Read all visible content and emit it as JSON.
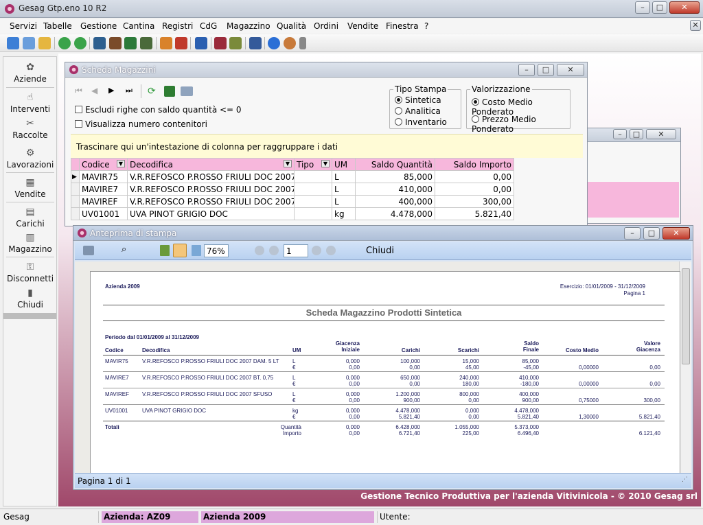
{
  "app": {
    "title": "Gesag Gtp.eno 10 R2",
    "footer": "Gestione Tecnico Produttiva per l'azienda Vitivinicola - © 2010 Gesag srl"
  },
  "menu": [
    "Servizi",
    "Tabelle",
    "Gestione",
    "Cantina",
    "Registri",
    "CdG",
    "Magazzino",
    "Qualità",
    "Ordini",
    "Vendite",
    "Finestra",
    "?"
  ],
  "toolbar_icons": [
    "home-icon",
    "window-icon",
    "folder-icon",
    "green-arrow-icon",
    "green-arrow-icon",
    "chart-icon",
    "book-icon",
    "book-icon",
    "export-icon",
    "report-icon",
    "report-icon",
    "grid-icon",
    "wine-icon",
    "truck-icon",
    "calendar-icon",
    "info-icon",
    "user-icon",
    "overflow-icon"
  ],
  "sidebar": [
    {
      "label": "Aziende",
      "icon": "flower-icon"
    },
    {
      "label": "Interventi",
      "icon": "hand-icon"
    },
    {
      "label": "Raccolte",
      "icon": "shears-icon"
    },
    {
      "label": "Lavorazioni",
      "icon": "machine-icon"
    },
    {
      "label": "Vendite",
      "icon": "register-icon"
    },
    {
      "label": "Carichi",
      "icon": "truck-icon"
    },
    {
      "label": "Magazzino",
      "icon": "warehouse-icon"
    },
    {
      "label": "Disconnetti",
      "icon": "key-icon"
    },
    {
      "label": "Chiudi",
      "icon": "door-icon"
    }
  ],
  "scheda": {
    "title": "Scheda Magazzini",
    "opt_escludi": "Escludi righe con saldo quantità <= 0",
    "opt_contenitori": "Visualizza numero contenitori",
    "tipo_stampa": {
      "label": "Tipo Stampa",
      "options": [
        "Sintetica",
        "Analitica",
        "Inventario"
      ],
      "selected": "Sintetica"
    },
    "valorizzazione": {
      "label": "Valorizzazione",
      "options": [
        "Costo Medio Ponderato",
        "Prezzo Medio Ponderato"
      ],
      "selected": "Costo Medio Ponderato"
    },
    "group_hint": "Trascinare qui un'intestazione di colonna per raggruppare i dati",
    "columns": [
      "Codice",
      "Decodifica",
      "Tipo",
      "UM",
      "Saldo Quantità",
      "Saldo Importo"
    ],
    "rows": [
      [
        "MAVIR75",
        "V.R.REFOSCO P.ROSSO FRIULI DOC 2007 DAM.",
        "",
        "L",
        "85,000",
        "0,00"
      ],
      [
        "MAVIRE7",
        "V.R.REFOSCO P.ROSSO FRIULI DOC 2007 BT. 0,",
        "",
        "L",
        "410,000",
        "0,00"
      ],
      [
        "MAVIREF",
        "V.R.REFOSCO P.ROSSO FRIULI DOC 2007 SFUSO",
        "",
        "L",
        "400,000",
        "300,00"
      ],
      [
        "UV01001",
        "UVA PINOT GRIGIO DOC",
        "",
        "kg",
        "4.478,000",
        "5.821,40"
      ]
    ]
  },
  "preview": {
    "title": "Anteprima di stampa",
    "zoom": "76%",
    "page": "1",
    "close_label": "Chiudi",
    "status": "Pagina 1 di 1",
    "report": {
      "company": "Azienda 2009",
      "exercise": "Esercizio: 01/01/2009 - 31/12/2009",
      "page_label": "Pagina 1",
      "title": "Scheda Magazzino Prodotti Sintetica",
      "period": "Periodo dal 01/01/2009 al 31/12/2009",
      "headers": {
        "codice": "Codice",
        "decodifica": "Decodifica",
        "um": "UM",
        "giac1": "Giacenza",
        "giac2": "Iniziale",
        "carichi": "Carichi",
        "scarichi": "Scarichi",
        "saldo1": "Saldo",
        "saldo2": "Finale",
        "costo": "Costo Medio",
        "val1": "Valore",
        "val2": "Giacenza"
      },
      "rows": [
        {
          "codice": "MAVIR75",
          "decodifica": "V.R.REFOSCO P.ROSSO FRIULI DOC 2007 DAM. 5 LT",
          "um": [
            "L",
            "€"
          ],
          "giac": [
            "0,000",
            "0,00"
          ],
          "carichi": [
            "100,000",
            "0,00"
          ],
          "scarichi": [
            "15,000",
            "45,00"
          ],
          "saldo": [
            "85,000",
            "-45,00"
          ],
          "costo": "0,00000",
          "valore": "0,00"
        },
        {
          "codice": "MAVIRE7",
          "decodifica": "V.R.REFOSCO P.ROSSO FRIULI DOC 2007 BT. 0,75",
          "um": [
            "L",
            "€"
          ],
          "giac": [
            "0,000",
            "0,00"
          ],
          "carichi": [
            "650,000",
            "0,00"
          ],
          "scarichi": [
            "240,000",
            "180,00"
          ],
          "saldo": [
            "410,000",
            "-180,00"
          ],
          "costo": "0,00000",
          "valore": "0,00"
        },
        {
          "codice": "MAVIREF",
          "decodifica": "V.R.REFOSCO P.ROSSO FRIULI DOC 2007 SFUSO",
          "um": [
            "L",
            "€"
          ],
          "giac": [
            "0,000",
            "0,00"
          ],
          "carichi": [
            "1.200,000",
            "900,00"
          ],
          "scarichi": [
            "800,000",
            "0,00"
          ],
          "saldo": [
            "400,000",
            "900,00"
          ],
          "costo": "0,75000",
          "valore": "300,00"
        },
        {
          "codice": "UV01001",
          "decodifica": "UVA PINOT GRIGIO DOC",
          "um": [
            "kg",
            "€"
          ],
          "giac": [
            "0,000",
            "0,00"
          ],
          "carichi": [
            "4.478,000",
            "5.821,40"
          ],
          "scarichi": [
            "0,000",
            "0,00"
          ],
          "saldo": [
            "4.478,000",
            "5.821,40"
          ],
          "costo": "1,30000",
          "valore": "5.821,40"
        }
      ],
      "totali": {
        "label": "Totali",
        "lbl": [
          "Quantità",
          "Importo"
        ],
        "giac": [
          "0,000",
          "0,00"
        ],
        "carichi": [
          "6.428,000",
          "6.721,40"
        ],
        "scarichi": [
          "1.055,000",
          "225,00"
        ],
        "saldo": [
          "5.373,000",
          "6.496,40"
        ],
        "valore": "6.121,40"
      }
    }
  },
  "status": {
    "app": "Gesag",
    "azienda": "Azienda: AZ09",
    "anno": "Azienda 2009",
    "utente": "Utente:"
  },
  "colors": {
    "accent_pink": "#f7b7dc",
    "desktop": "#a0486a",
    "group_hint_bg": "#fffbd6",
    "preview_toolbar": "#b9d1f0"
  }
}
